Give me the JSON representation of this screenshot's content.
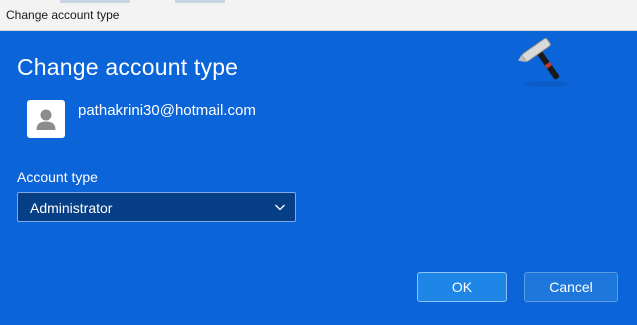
{
  "window": {
    "title": "Change account type"
  },
  "dialog": {
    "heading": "Change account type",
    "user_email": "pathakrini30@hotmail.com",
    "account_type_label": "Account type",
    "account_type_selected": "Administrator",
    "ok_label": "OK",
    "cancel_label": "Cancel"
  },
  "watermark": {
    "logo_icon": "hammer-logo-icon"
  },
  "colors": {
    "dialog_background": "#0b64d8",
    "titlebar_background": "#f3f3f3",
    "select_background": "#073f86",
    "primary_button": "#1e86e6"
  }
}
